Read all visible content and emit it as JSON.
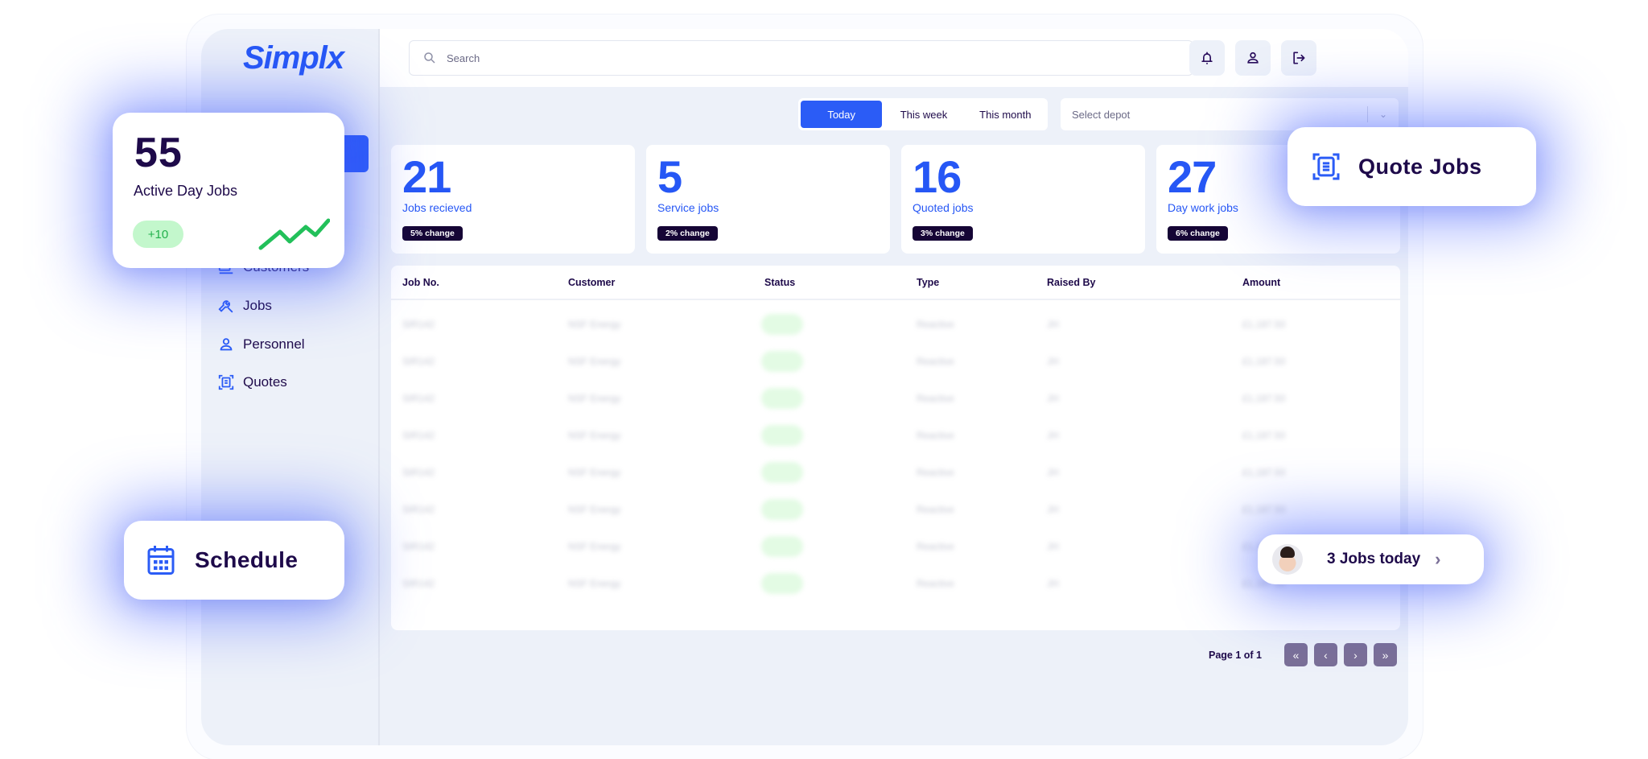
{
  "app": {
    "logo": "Simplx",
    "brand_color": "#2657f5"
  },
  "sidebar": {
    "items": [
      {
        "label": "Customers",
        "icon": "customers-icon"
      },
      {
        "label": "Jobs",
        "icon": "wrench-icon"
      },
      {
        "label": "Personnel",
        "icon": "user-icon"
      },
      {
        "label": "Quotes",
        "icon": "document-scan-icon"
      }
    ]
  },
  "topbar": {
    "search_placeholder": "Search",
    "buttons": [
      "bell-icon",
      "user-icon",
      "logout-icon"
    ]
  },
  "filters": {
    "periods": [
      {
        "label": "Today",
        "active": true
      },
      {
        "label": "This week",
        "active": false
      },
      {
        "label": "This month",
        "active": false
      }
    ],
    "depot_placeholder": "Select depot"
  },
  "stats": [
    {
      "value": "21",
      "label": "Jobs recieved",
      "change": "5% change"
    },
    {
      "value": "5",
      "label": "Service jobs",
      "change": "2% change"
    },
    {
      "value": "16",
      "label": "Quoted jobs",
      "change": "3% change"
    },
    {
      "value": "27",
      "label": "Day work jobs",
      "change": "6% change"
    }
  ],
  "table": {
    "columns": [
      "Job No.",
      "Customer",
      "Status",
      "Type",
      "Raised By",
      "Amount"
    ],
    "rows": [
      {
        "job": "SIR142",
        "customer": "NSF Energy",
        "type": "Reactive",
        "raised_by": "JH",
        "amount": "£1,187.50"
      },
      {
        "job": "SIR142",
        "customer": "NSF Energy",
        "type": "Reactive",
        "raised_by": "JH",
        "amount": "£1,187.50"
      },
      {
        "job": "SIR142",
        "customer": "NSF Energy",
        "type": "Reactive",
        "raised_by": "JH",
        "amount": "£1,187.50"
      },
      {
        "job": "SIR142",
        "customer": "NSF Energy",
        "type": "Reactive",
        "raised_by": "JH",
        "amount": "£1,187.50"
      },
      {
        "job": "SIR142",
        "customer": "NSF Energy",
        "type": "Reactive",
        "raised_by": "JH",
        "amount": "£1,187.50"
      },
      {
        "job": "SIR142",
        "customer": "NSF Energy",
        "type": "Reactive",
        "raised_by": "JH",
        "amount": "£1,187.50"
      },
      {
        "job": "SIR142",
        "customer": "NSF Energy",
        "type": "Reactive",
        "raised_by": "JH",
        "amount": "£1,187.50"
      },
      {
        "job": "SIR142",
        "customer": "NSF Energy",
        "type": "Reactive",
        "raised_by": "JH",
        "amount": "£1,187.50"
      }
    ]
  },
  "pagination": {
    "label": "Page 1 of 1",
    "buttons": [
      {
        "name": "first-page",
        "glyph": "«"
      },
      {
        "name": "prev-page",
        "glyph": "‹"
      },
      {
        "name": "next-page",
        "glyph": "›"
      },
      {
        "name": "last-page",
        "glyph": "»"
      }
    ]
  },
  "overlays": {
    "active_jobs": {
      "value": "55",
      "label": "Active Day Jobs",
      "delta": "+10"
    },
    "quote_jobs": {
      "label": "Quote Jobs"
    },
    "schedule": {
      "label": "Schedule"
    },
    "jobs_today": {
      "label": "3 Jobs today",
      "chevron": "›"
    }
  }
}
